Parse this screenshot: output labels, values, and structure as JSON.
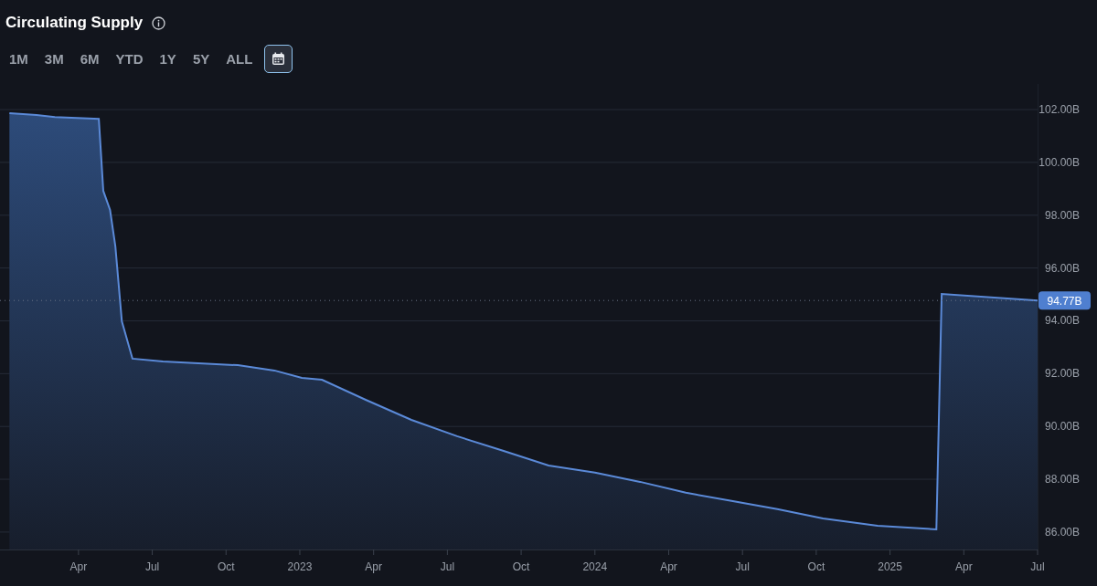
{
  "header": {
    "title": "Circulating Supply"
  },
  "range_buttons": [
    {
      "label": "1M",
      "selected": false
    },
    {
      "label": "3M",
      "selected": false
    },
    {
      "label": "6M",
      "selected": false
    },
    {
      "label": "YTD",
      "selected": false
    },
    {
      "label": "1Y",
      "selected": false
    },
    {
      "label": "5Y",
      "selected": false
    },
    {
      "label": "ALL",
      "selected": false
    }
  ],
  "custom_range": {
    "selected": true
  },
  "chart": {
    "chart_data": {
      "type": "area",
      "x": [
        2022.016,
        2022.108,
        2022.17,
        2022.319,
        2022.334,
        2022.357,
        2022.375,
        2022.397,
        2022.433,
        2022.536,
        2022.79,
        2022.914,
        2023.007,
        2023.075,
        2023.223,
        2023.378,
        2023.533,
        2023.688,
        2023.843,
        2024.0,
        2024.153,
        2024.308,
        2024.463,
        2024.618,
        2024.773,
        2024.958,
        2025.157,
        2025.175,
        2025.5
      ],
      "series": [
        {
          "color": "#5b8ad8",
          "values": [
            101.86,
            101.79,
            101.72,
            101.65,
            98.92,
            98.2,
            96.82,
            93.98,
            92.57,
            92.46,
            92.32,
            92.12,
            91.84,
            91.77,
            91.01,
            90.25,
            89.63,
            89.08,
            88.52,
            88.25,
            87.9,
            87.49,
            87.18,
            86.87,
            86.52,
            86.24,
            86.1,
            95.02,
            94.77
          ]
        }
      ],
      "xlim": [
        2021.984,
        2025.5
      ],
      "ylim": [
        85.34,
        102.97
      ],
      "grid": true,
      "ref_lines": [
        {
          "axis": "y",
          "value": 94.77
        }
      ],
      "xticks": [
        {
          "value": 2022.25,
          "label": "Apr"
        },
        {
          "value": 2022.5,
          "label": "Jul"
        },
        {
          "value": 2022.75,
          "label": "Oct"
        },
        {
          "value": 2023,
          "label": "2023"
        },
        {
          "value": 2023.25,
          "label": "Apr"
        },
        {
          "value": 2023.5,
          "label": "Jul"
        },
        {
          "value": 2023.75,
          "label": "Oct"
        },
        {
          "value": 2024,
          "label": "2024"
        },
        {
          "value": 2024.25,
          "label": "Apr"
        },
        {
          "value": 2024.5,
          "label": "Jul"
        },
        {
          "value": 2024.75,
          "label": "Oct"
        },
        {
          "value": 2025,
          "label": "2025"
        },
        {
          "value": 2025.25,
          "label": "Apr"
        },
        {
          "value": 2025.5,
          "label": "Jul"
        }
      ],
      "yticks": [
        {
          "value": 86,
          "label": "86.00B"
        },
        {
          "value": 88,
          "label": "88.00B"
        },
        {
          "value": 90,
          "label": "90.00B"
        },
        {
          "value": 92,
          "label": "92.00B"
        },
        {
          "value": 94,
          "label": "94.00B"
        },
        {
          "value": 96,
          "label": "96.00B"
        },
        {
          "value": 98,
          "label": "98.00B"
        },
        {
          "value": 100,
          "label": "100.00B"
        },
        {
          "value": 102,
          "label": "102.00B"
        }
      ],
      "annotations": [
        "94.77B"
      ]
    }
  }
}
